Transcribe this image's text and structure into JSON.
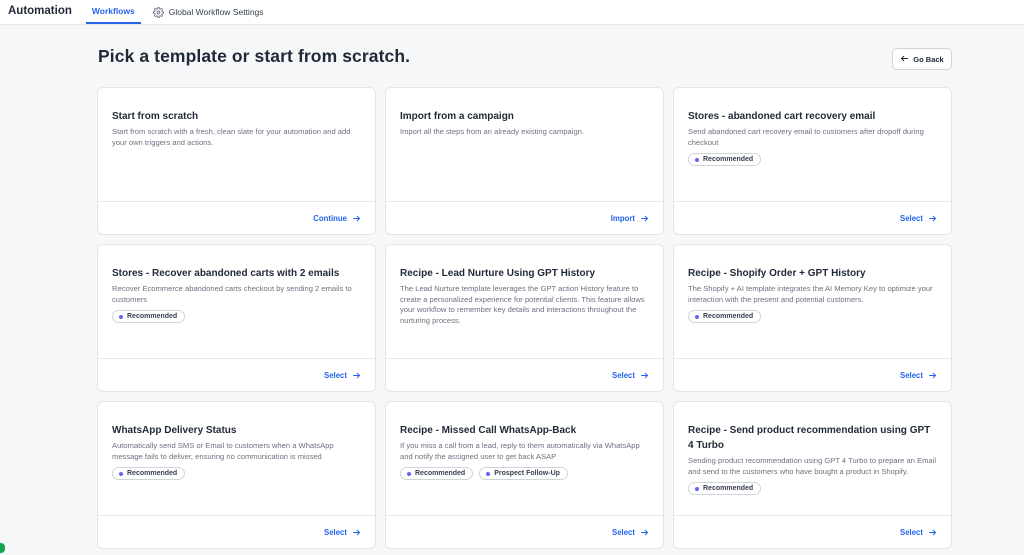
{
  "topbar": {
    "app_title": "Automation",
    "tabs": [
      {
        "label": "Workflows",
        "active": true
      },
      {
        "label": "Global Workflow Settings",
        "icon": "gear-icon"
      }
    ]
  },
  "page": {
    "title": "Pick a template or start from scratch.",
    "go_back_label": "Go Back"
  },
  "cards": [
    {
      "title": "Start from scratch",
      "description": "Start from scratch with a fresh, clean slate for your automation and add your own triggers and actions.",
      "badges": [],
      "action": "Continue"
    },
    {
      "title": "Import from a campaign",
      "description": "Import all the steps from an already existing campaign.",
      "badges": [],
      "action": "Import"
    },
    {
      "title": "Stores - abandoned cart recovery email",
      "description": "Send abandoned cart recovery email to customers after dropoff during checkout",
      "badges": [
        "Recommended"
      ],
      "action": "Select"
    },
    {
      "title": "Stores - Recover abandoned carts with 2 emails",
      "description": "Recover Ecommerce abandoned carts checkout by sending 2 emails to customers",
      "badges": [
        "Recommended"
      ],
      "action": "Select"
    },
    {
      "title": "Recipe - Lead Nurture Using GPT History",
      "description": "The Lead Nurture template leverages the GPT action History feature to create a personalized experience for potential clients. This feature allows your workflow to remember key details and interactions throughout the nurturing process.",
      "badges": [],
      "action": "Select"
    },
    {
      "title": "Recipe - Shopify Order + GPT History",
      "description": "The Shopify + AI template integrates the AI Memory Key to optimize your interaction with the present and potential customers.",
      "badges": [
        "Recommended"
      ],
      "action": "Select"
    },
    {
      "title": "WhatsApp Delivery Status",
      "description": "Automatically send SMS or Email to customers when a WhatsApp message fails to deliver, ensuring no communication is missed",
      "badges": [
        "Recommended"
      ],
      "action": "Select"
    },
    {
      "title": "Recipe - Missed Call WhatsApp-Back",
      "description": "If you miss a call from a lead, reply to them automatically via WhatsApp and notify the assigned user to get back ASAP",
      "badges": [
        "Recommended",
        "Prospect Follow-Up"
      ],
      "action": "Select"
    },
    {
      "title": "Recipe - Send product recommendation using GPT 4 Turbo",
      "description": "Sending product recommendation using GPT 4 Turbo to prepare an Email and send to the customers who have bought a product in Shopify.",
      "badges": [
        "Recommended"
      ],
      "action": "Select"
    }
  ],
  "colors": {
    "accent": "#2563eb",
    "badge_dot": "#6366f1",
    "background": "#f6f7f9"
  }
}
